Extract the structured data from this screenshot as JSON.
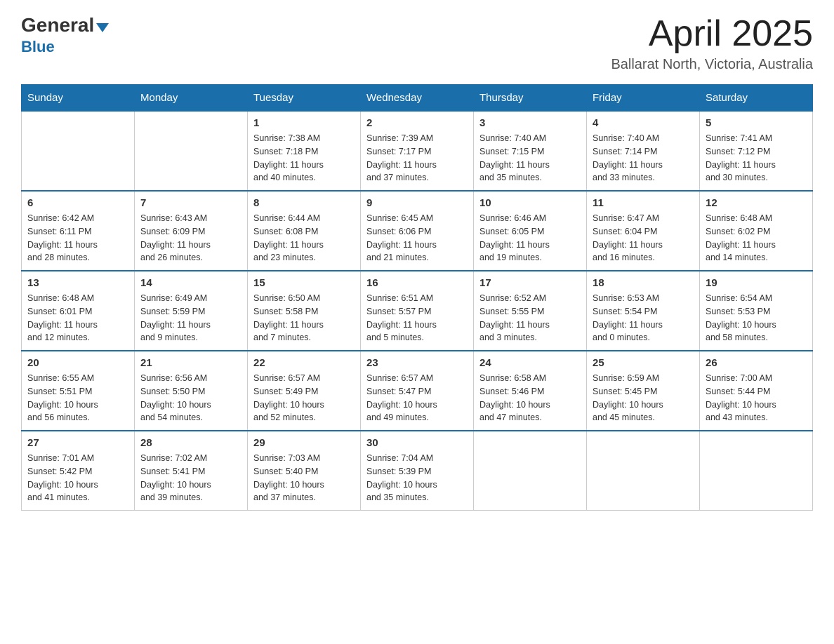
{
  "logo": {
    "general": "General",
    "blue": "Blue"
  },
  "title": {
    "month_year": "April 2025",
    "location": "Ballarat North, Victoria, Australia"
  },
  "headers": [
    "Sunday",
    "Monday",
    "Tuesday",
    "Wednesday",
    "Thursday",
    "Friday",
    "Saturday"
  ],
  "weeks": [
    {
      "days": [
        {
          "number": "",
          "info": ""
        },
        {
          "number": "",
          "info": ""
        },
        {
          "number": "1",
          "info": "Sunrise: 7:38 AM\nSunset: 7:18 PM\nDaylight: 11 hours\nand 40 minutes."
        },
        {
          "number": "2",
          "info": "Sunrise: 7:39 AM\nSunset: 7:17 PM\nDaylight: 11 hours\nand 37 minutes."
        },
        {
          "number": "3",
          "info": "Sunrise: 7:40 AM\nSunset: 7:15 PM\nDaylight: 11 hours\nand 35 minutes."
        },
        {
          "number": "4",
          "info": "Sunrise: 7:40 AM\nSunset: 7:14 PM\nDaylight: 11 hours\nand 33 minutes."
        },
        {
          "number": "5",
          "info": "Sunrise: 7:41 AM\nSunset: 7:12 PM\nDaylight: 11 hours\nand 30 minutes."
        }
      ]
    },
    {
      "days": [
        {
          "number": "6",
          "info": "Sunrise: 6:42 AM\nSunset: 6:11 PM\nDaylight: 11 hours\nand 28 minutes."
        },
        {
          "number": "7",
          "info": "Sunrise: 6:43 AM\nSunset: 6:09 PM\nDaylight: 11 hours\nand 26 minutes."
        },
        {
          "number": "8",
          "info": "Sunrise: 6:44 AM\nSunset: 6:08 PM\nDaylight: 11 hours\nand 23 minutes."
        },
        {
          "number": "9",
          "info": "Sunrise: 6:45 AM\nSunset: 6:06 PM\nDaylight: 11 hours\nand 21 minutes."
        },
        {
          "number": "10",
          "info": "Sunrise: 6:46 AM\nSunset: 6:05 PM\nDaylight: 11 hours\nand 19 minutes."
        },
        {
          "number": "11",
          "info": "Sunrise: 6:47 AM\nSunset: 6:04 PM\nDaylight: 11 hours\nand 16 minutes."
        },
        {
          "number": "12",
          "info": "Sunrise: 6:48 AM\nSunset: 6:02 PM\nDaylight: 11 hours\nand 14 minutes."
        }
      ]
    },
    {
      "days": [
        {
          "number": "13",
          "info": "Sunrise: 6:48 AM\nSunset: 6:01 PM\nDaylight: 11 hours\nand 12 minutes."
        },
        {
          "number": "14",
          "info": "Sunrise: 6:49 AM\nSunset: 5:59 PM\nDaylight: 11 hours\nand 9 minutes."
        },
        {
          "number": "15",
          "info": "Sunrise: 6:50 AM\nSunset: 5:58 PM\nDaylight: 11 hours\nand 7 minutes."
        },
        {
          "number": "16",
          "info": "Sunrise: 6:51 AM\nSunset: 5:57 PM\nDaylight: 11 hours\nand 5 minutes."
        },
        {
          "number": "17",
          "info": "Sunrise: 6:52 AM\nSunset: 5:55 PM\nDaylight: 11 hours\nand 3 minutes."
        },
        {
          "number": "18",
          "info": "Sunrise: 6:53 AM\nSunset: 5:54 PM\nDaylight: 11 hours\nand 0 minutes."
        },
        {
          "number": "19",
          "info": "Sunrise: 6:54 AM\nSunset: 5:53 PM\nDaylight: 10 hours\nand 58 minutes."
        }
      ]
    },
    {
      "days": [
        {
          "number": "20",
          "info": "Sunrise: 6:55 AM\nSunset: 5:51 PM\nDaylight: 10 hours\nand 56 minutes."
        },
        {
          "number": "21",
          "info": "Sunrise: 6:56 AM\nSunset: 5:50 PM\nDaylight: 10 hours\nand 54 minutes."
        },
        {
          "number": "22",
          "info": "Sunrise: 6:57 AM\nSunset: 5:49 PM\nDaylight: 10 hours\nand 52 minutes."
        },
        {
          "number": "23",
          "info": "Sunrise: 6:57 AM\nSunset: 5:47 PM\nDaylight: 10 hours\nand 49 minutes."
        },
        {
          "number": "24",
          "info": "Sunrise: 6:58 AM\nSunset: 5:46 PM\nDaylight: 10 hours\nand 47 minutes."
        },
        {
          "number": "25",
          "info": "Sunrise: 6:59 AM\nSunset: 5:45 PM\nDaylight: 10 hours\nand 45 minutes."
        },
        {
          "number": "26",
          "info": "Sunrise: 7:00 AM\nSunset: 5:44 PM\nDaylight: 10 hours\nand 43 minutes."
        }
      ]
    },
    {
      "days": [
        {
          "number": "27",
          "info": "Sunrise: 7:01 AM\nSunset: 5:42 PM\nDaylight: 10 hours\nand 41 minutes."
        },
        {
          "number": "28",
          "info": "Sunrise: 7:02 AM\nSunset: 5:41 PM\nDaylight: 10 hours\nand 39 minutes."
        },
        {
          "number": "29",
          "info": "Sunrise: 7:03 AM\nSunset: 5:40 PM\nDaylight: 10 hours\nand 37 minutes."
        },
        {
          "number": "30",
          "info": "Sunrise: 7:04 AM\nSunset: 5:39 PM\nDaylight: 10 hours\nand 35 minutes."
        },
        {
          "number": "",
          "info": ""
        },
        {
          "number": "",
          "info": ""
        },
        {
          "number": "",
          "info": ""
        }
      ]
    }
  ]
}
